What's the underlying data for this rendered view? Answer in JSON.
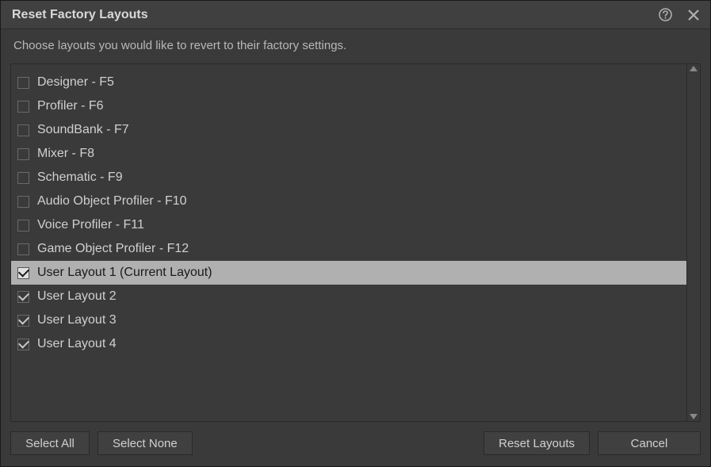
{
  "titlebar": {
    "title": "Reset Factory Layouts"
  },
  "subtitle": "Choose layouts you would like to revert to their factory settings.",
  "layouts": [
    {
      "label": "Designer - F5",
      "checked": false,
      "selected": false
    },
    {
      "label": "Profiler - F6",
      "checked": false,
      "selected": false
    },
    {
      "label": "SoundBank - F7",
      "checked": false,
      "selected": false
    },
    {
      "label": "Mixer - F8",
      "checked": false,
      "selected": false
    },
    {
      "label": "Schematic - F9",
      "checked": false,
      "selected": false
    },
    {
      "label": "Audio Object Profiler - F10",
      "checked": false,
      "selected": false
    },
    {
      "label": "Voice Profiler - F11",
      "checked": false,
      "selected": false
    },
    {
      "label": "Game Object Profiler - F12",
      "checked": false,
      "selected": false
    },
    {
      "label": "User Layout 1 (Current Layout)",
      "checked": true,
      "selected": true
    },
    {
      "label": "User Layout 2",
      "checked": true,
      "selected": false
    },
    {
      "label": "User Layout 3",
      "checked": true,
      "selected": false
    },
    {
      "label": "User Layout 4",
      "checked": true,
      "selected": false
    }
  ],
  "buttons": {
    "select_all": "Select All",
    "select_none": "Select None",
    "reset": "Reset Layouts",
    "cancel": "Cancel"
  }
}
